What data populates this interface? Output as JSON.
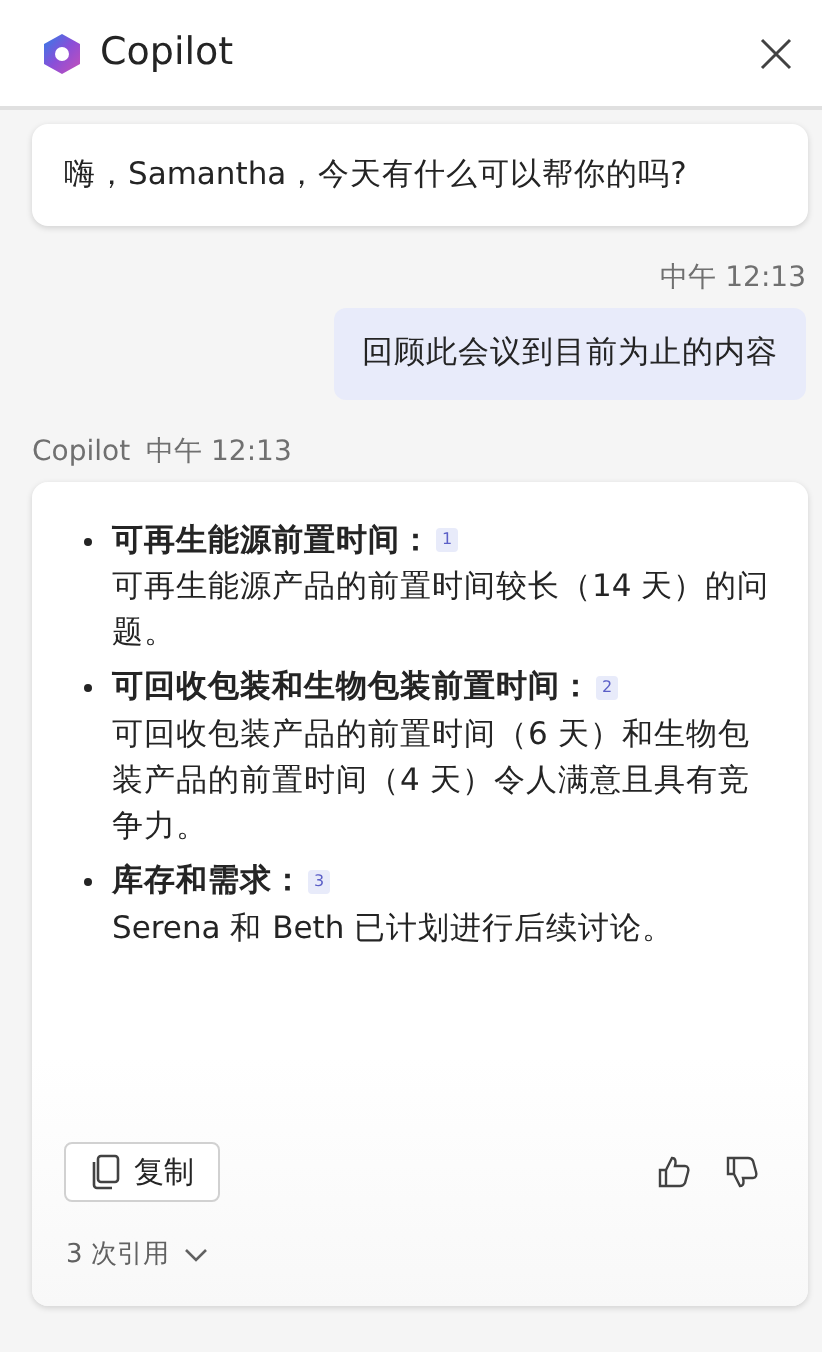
{
  "header": {
    "title": "Copilot"
  },
  "greeting": "嗨，Samantha，今天有什么可以帮你的吗?",
  "user_message": {
    "time": "中午 12:13",
    "text": "回顾此会议到目前为止的内容"
  },
  "reply": {
    "sender": "Copilot",
    "time": "中午 12:13",
    "points": [
      {
        "title": "可再生能源前置时间：",
        "citation": "1",
        "text": "可再生能源产品的前置时间较长（14 天）的问题。"
      },
      {
        "title": "可回收包装和生物包装前置时间：",
        "citation": "2",
        "text": "可回收包装产品的前置时间（6 天）和生物包装产品的前置时间（4 天）令人满意且具有竞争力。"
      },
      {
        "title": "库存和需求：",
        "citation": "3",
        "text": "Serena 和 Beth 已计划进行后续讨论。"
      }
    ],
    "copy_label": "复制",
    "references": "3 次引用"
  }
}
